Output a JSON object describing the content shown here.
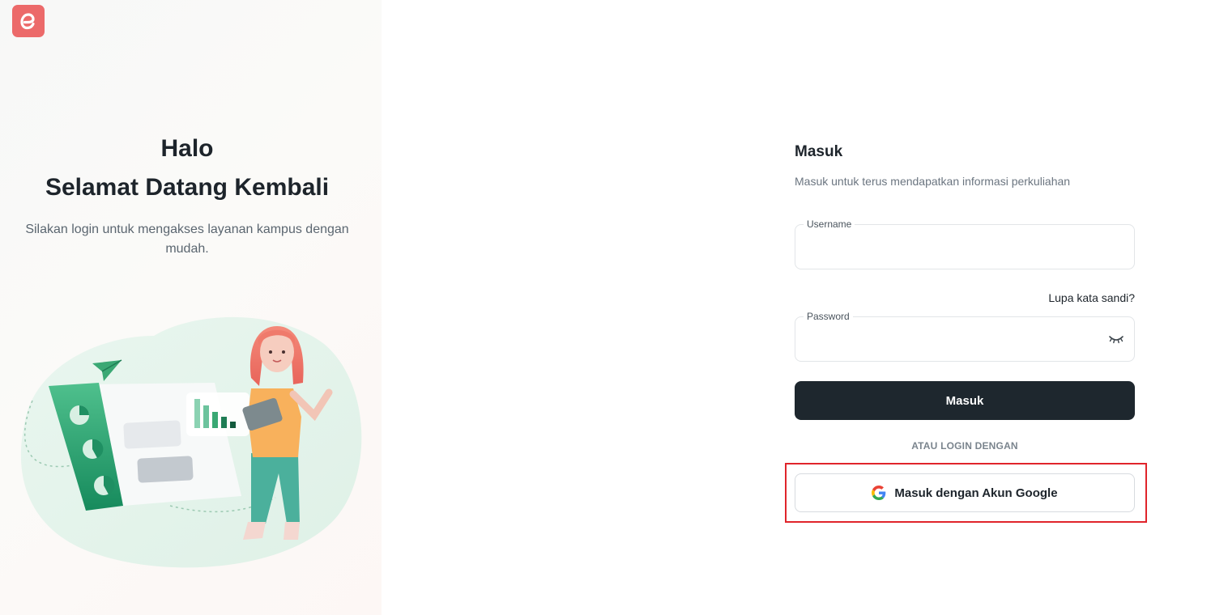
{
  "hero": {
    "greeting": "Halo",
    "title": "Selamat Datang Kembali",
    "subtitle": "Silakan login untuk mengakses layanan kampus dengan mudah."
  },
  "form": {
    "title": "Masuk",
    "subtitle": "Masuk untuk terus mendapatkan informasi perkuliahan",
    "username": {
      "label": "Username",
      "value": "",
      "placeholder": ""
    },
    "forgot_link": "Lupa kata sandi?",
    "password": {
      "label": "Password",
      "value": "",
      "placeholder": ""
    },
    "submit_label": "Masuk",
    "divider_text": "ATAU LOGIN DENGAN",
    "google_label": "Masuk dengan Akun Google"
  },
  "icons": {
    "logo": "app-logo-icon",
    "eye": "eye-closed-icon",
    "google": "google-icon"
  },
  "colors": {
    "brand": "#ec6a6a",
    "primary_button": "#1e272e",
    "accent_green": "#2e9e73",
    "highlight": "#e0242b"
  }
}
